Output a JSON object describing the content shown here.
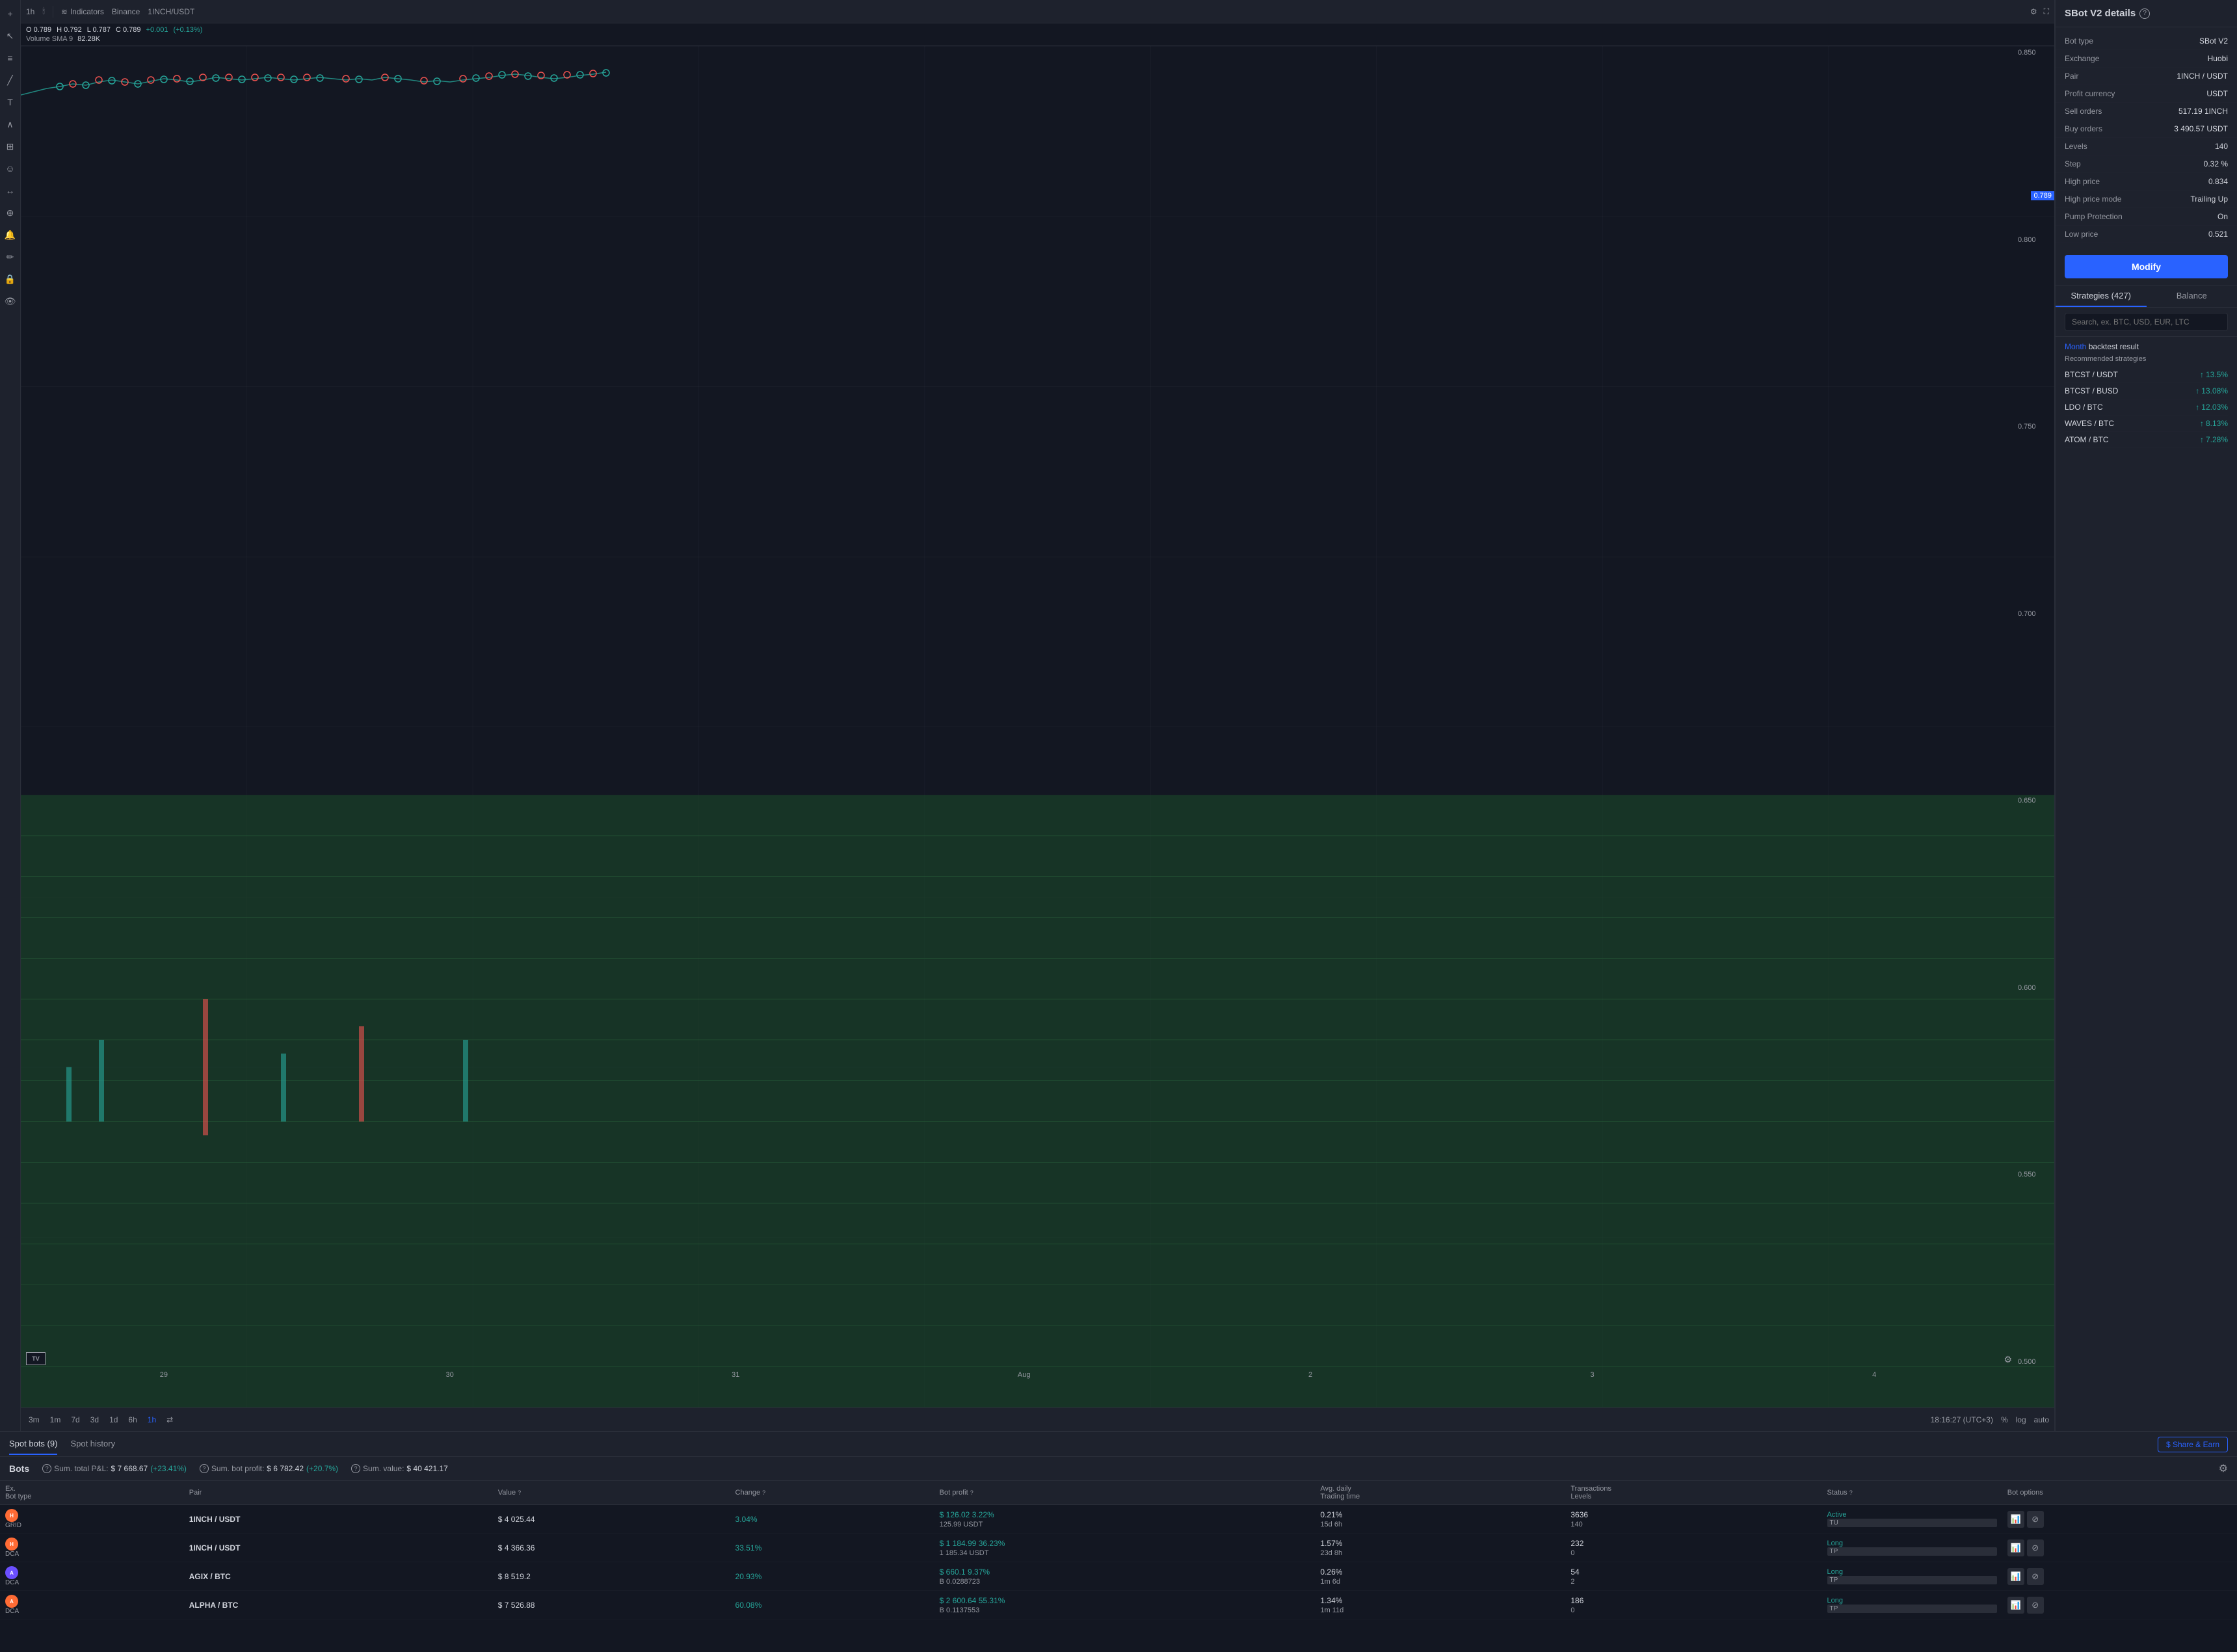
{
  "chart": {
    "timeframe": "1h",
    "symbol": "1INCH/USDT",
    "exchange_label": "Binance",
    "indicator_label": "Indicators",
    "ohlc": {
      "open_label": "O",
      "open": "0.789",
      "high_label": "H",
      "high": "0.792",
      "low_label": "L",
      "low": "0.787",
      "close_label": "C",
      "close": "0.789",
      "change": "+0.001",
      "change_pct": "(+0.13%)"
    },
    "volume_label": "Volume SMA 9",
    "volume_value": "82.28K",
    "price_levels": [
      "0.850",
      "0.800",
      "0.750",
      "0.700",
      "0.650",
      "0.600",
      "0.550",
      "0.500"
    ],
    "time_labels": [
      "29",
      "30",
      "31",
      "Aug",
      "2",
      "3",
      "4"
    ],
    "current_price": "0.789",
    "timeframes": [
      "3m",
      "1m",
      "7d",
      "3d",
      "1d",
      "6h",
      "1h"
    ],
    "active_timeframe": "1h",
    "timestamp": "18:16:27 (UTC+3)",
    "chart_settings": [
      "log",
      "auto",
      "%"
    ],
    "settings_icon": "⚙",
    "fullscreen_icon": "⛶",
    "sync_icon": "⇄",
    "gear_icon": "⚙"
  },
  "left_tools": {
    "tools": [
      {
        "name": "crosshair",
        "icon": "+"
      },
      {
        "name": "cursor",
        "icon": "↖"
      },
      {
        "name": "lines",
        "icon": "≡"
      },
      {
        "name": "draw-line",
        "icon": "/"
      },
      {
        "name": "text",
        "icon": "T"
      },
      {
        "name": "shapes",
        "icon": "∧"
      },
      {
        "name": "patterns",
        "icon": "⊞"
      },
      {
        "name": "emoji",
        "icon": "☺"
      },
      {
        "name": "measure",
        "icon": "⟷"
      },
      {
        "name": "zoom",
        "icon": "⊕"
      },
      {
        "name": "alert",
        "icon": "🔔"
      },
      {
        "name": "draw-pencil",
        "icon": "✏"
      },
      {
        "name": "lock",
        "icon": "🔒"
      },
      {
        "name": "eye",
        "icon": "👁"
      }
    ]
  },
  "sbot": {
    "title": "SBot V2 details",
    "help": "?",
    "details": [
      {
        "label": "Bot type",
        "value": "SBot V2"
      },
      {
        "label": "Exchange",
        "value": "Huobi"
      },
      {
        "label": "Pair",
        "value": "1INCH / USDT"
      },
      {
        "label": "Profit currency",
        "value": "USDT"
      },
      {
        "label": "Sell orders",
        "value": "517.19 1INCH"
      },
      {
        "label": "Buy orders",
        "value": "3 490.57 USDT"
      },
      {
        "label": "Levels",
        "value": "140"
      },
      {
        "label": "Step",
        "value": "0.32 %"
      },
      {
        "label": "High price",
        "value": "0.834"
      },
      {
        "label": "High price mode",
        "value": "Trailing Up"
      },
      {
        "label": "Pump Protection",
        "value": "On"
      },
      {
        "label": "Low price",
        "value": "0.521"
      }
    ],
    "modify_btn": "Modify",
    "strategies_tab": "Strategies (427)",
    "balance_tab": "Balance",
    "search_placeholder": "Search, ex. BTC, USD, EUR, LTC",
    "backtest_month": "Month",
    "backtest_label": "backtest result",
    "recommended_label": "Recommended strategies",
    "strategies": [
      {
        "name": "BTCST / USDT",
        "gain": "↑ 13.5%"
      },
      {
        "name": "BTCST / BUSD",
        "gain": "↑ 13.08%"
      },
      {
        "name": "LDO / BTC",
        "gain": "↑ 12.03%"
      },
      {
        "name": "WAVES / BTC",
        "gain": "↑ 8.13%"
      },
      {
        "name": "ATOM / BTC",
        "gain": "↑ 7.28%"
      }
    ]
  },
  "bottom": {
    "tabs": [
      {
        "label": "Spot bots (9)",
        "active": true
      },
      {
        "label": "Spot history",
        "active": false
      }
    ],
    "share_earn_btn": "$ Share & Earn",
    "bots_title": "Bots",
    "stats": [
      {
        "label": "Sum. total P&L:",
        "value": "$ 7 668.67",
        "change": "(+23.41%)"
      },
      {
        "label": "Sum. bot profit:",
        "value": "$ 6 782.42",
        "change": "(+20.7%)"
      },
      {
        "label": "Sum. value:",
        "value": "$ 40 421.17"
      }
    ],
    "table_headers": [
      {
        "label": "Ex.",
        "sub": "Bot type"
      },
      {
        "label": "Pair"
      },
      {
        "label": "Value"
      },
      {
        "label": "Change"
      },
      {
        "label": "Bot profit"
      },
      {
        "label": "Avg. daily\nTrading time"
      },
      {
        "label": "Transactions\nLevels"
      },
      {
        "label": "Status"
      },
      {
        "label": "Bot options"
      }
    ],
    "bots": [
      {
        "exchange": "huobi",
        "exchange_icon": "H",
        "exchange_color": "#ff6b35",
        "pair": "1INCH / USDT",
        "bot_type": "GRID",
        "value": "$ 4 025.44",
        "change": "3.04%",
        "profit": "$ 126.02",
        "profit_pct": "3.22%",
        "profit_sub": "125.99 USDT",
        "avg_daily": "0.21%",
        "trading_time": "15d 6h",
        "transactions": "3636",
        "levels": "140",
        "status": "Active",
        "status_badge": "TU"
      },
      {
        "exchange": "huobi",
        "exchange_icon": "H",
        "exchange_color": "#ff6b35",
        "pair": "1INCH / USDT",
        "bot_type": "DCA",
        "value": "$ 4 366.36",
        "change": "33.51%",
        "profit": "$ 1 184.99",
        "profit_pct": "36.23%",
        "profit_sub": "1 185.34 USDT",
        "avg_daily": "1.57%",
        "trading_time": "23d 8h",
        "transactions": "232",
        "levels": "0",
        "status": "Long",
        "status_badge": "TP"
      },
      {
        "exchange": "agix",
        "exchange_icon": "A",
        "exchange_color": "#6b4fff",
        "pair": "AGIX / BTC",
        "bot_type": "DCA",
        "value": "$ 8 519.2",
        "change": "20.93%",
        "profit": "$ 660.1",
        "profit_pct": "9.37%",
        "profit_sub": "B 0.0288723",
        "avg_daily": "0.26%",
        "trading_time": "1m 6d",
        "transactions": "54",
        "levels": "2",
        "status": "Long",
        "status_badge": "TP"
      },
      {
        "exchange": "alpha",
        "exchange_icon": "A",
        "exchange_color": "#ff6b35",
        "pair": "ALPHA / BTC",
        "bot_type": "DCA",
        "value": "$ 7 526.88",
        "change": "60.08%",
        "profit": "$ 2 600.64",
        "profit_pct": "55.31%",
        "profit_sub": "B 0.1137553",
        "avg_daily": "1.34%",
        "trading_time": "1m 11d",
        "transactions": "186",
        "levels": "0",
        "status": "Long",
        "status_badge": "TP"
      }
    ]
  }
}
